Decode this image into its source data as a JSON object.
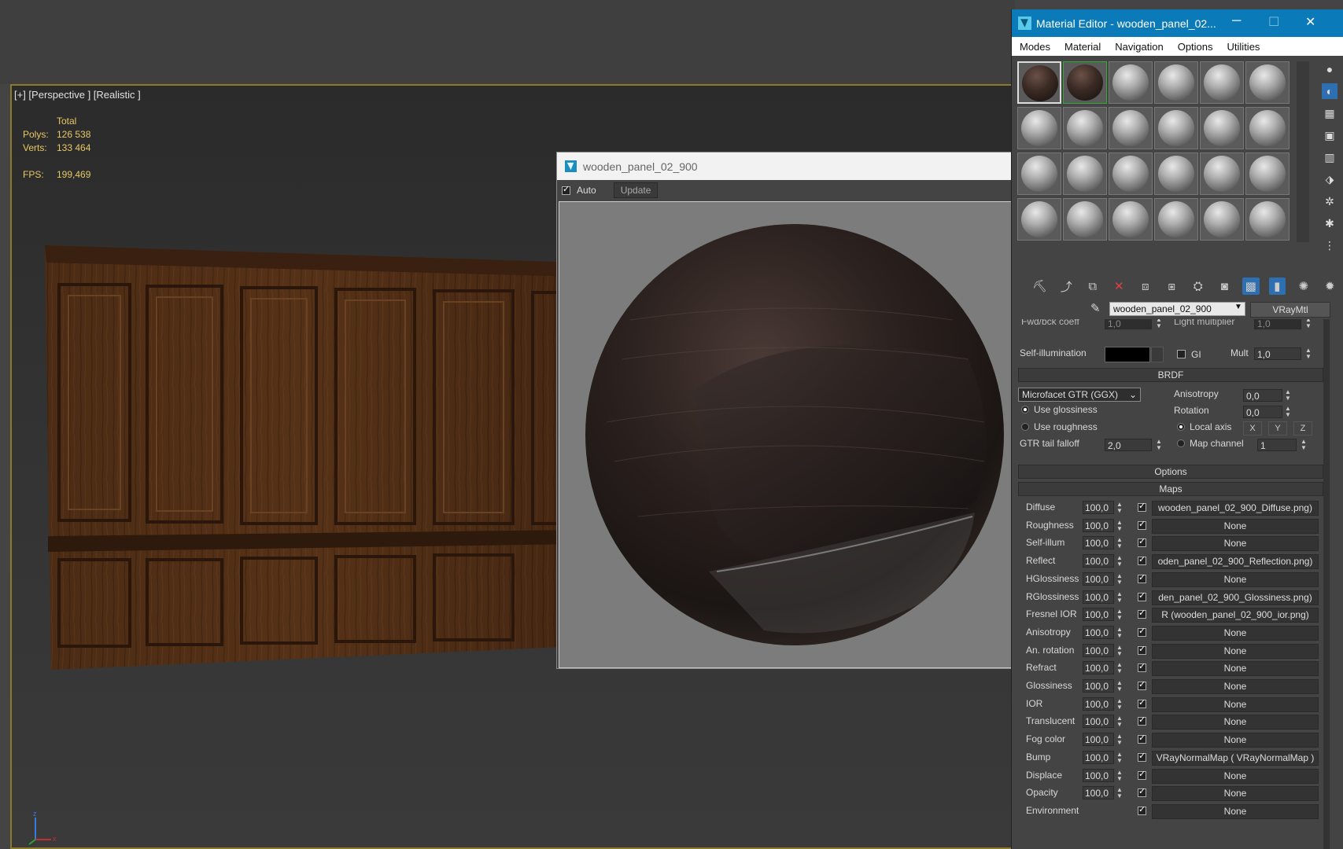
{
  "viewport": {
    "label": "[+] [Perspective ] [Realistic ]",
    "stats": {
      "header": "Total",
      "polys_label": "Polys:",
      "polys_value": "126 538",
      "verts_label": "Verts:",
      "verts_value": "133 464",
      "fps_label": "FPS:",
      "fps_value": "199,469"
    }
  },
  "preview_window": {
    "title": "wooden_panel_02_900",
    "auto_label": "Auto",
    "auto_checked": true,
    "update_label": "Update"
  },
  "material_editor": {
    "title": "Material Editor - wooden_panel_02...",
    "menu": [
      "Modes",
      "Material",
      "Navigation",
      "Options",
      "Utilities"
    ],
    "material_name": "wooden_panel_02_900",
    "material_type": "VRayMtl",
    "params": {
      "fwd_bck_label": "Fwd/bck coeff",
      "fwd_bck_value": "1,0",
      "light_mult_label": "Light multiplier",
      "light_mult_value": "1,0",
      "self_illum_label": "Self-illumination",
      "gi_label": "GI",
      "mult_label": "Mult",
      "mult_value": "1,0"
    },
    "brdf": {
      "rollout": "BRDF",
      "type": "Microfacet GTR (GGX)",
      "use_glossiness": "Use glossiness",
      "use_roughness": "Use roughness",
      "gtr_label": "GTR tail falloff",
      "gtr_value": "2,0",
      "anisotropy_label": "Anisotropy",
      "anisotropy_value": "0,0",
      "rotation_label": "Rotation",
      "rotation_value": "0,0",
      "local_axis_label": "Local axis",
      "x": "X",
      "y": "Y",
      "z": "Z",
      "map_channel_label": "Map channel",
      "map_channel_value": "1"
    },
    "options_rollout": "Options",
    "maps_rollout": "Maps",
    "maps": [
      {
        "label": "Diffuse",
        "value": "100,0",
        "map": "wooden_panel_02_900_Diffuse.png)"
      },
      {
        "label": "Roughness",
        "value": "100,0",
        "map": "None"
      },
      {
        "label": "Self-illum",
        "value": "100,0",
        "map": "None"
      },
      {
        "label": "Reflect",
        "value": "100,0",
        "map": "oden_panel_02_900_Reflection.png)"
      },
      {
        "label": "HGlossiness",
        "value": "100,0",
        "map": "None"
      },
      {
        "label": "RGlossiness",
        "value": "100,0",
        "map": "den_panel_02_900_Glossiness.png)"
      },
      {
        "label": "Fresnel IOR",
        "value": "100,0",
        "map": "R (wooden_panel_02_900_ior.png)"
      },
      {
        "label": "Anisotropy",
        "value": "100,0",
        "map": "None"
      },
      {
        "label": "An. rotation",
        "value": "100,0",
        "map": "None"
      },
      {
        "label": "Refract",
        "value": "100,0",
        "map": "None"
      },
      {
        "label": "Glossiness",
        "value": "100,0",
        "map": "None"
      },
      {
        "label": "IOR",
        "value": "100,0",
        "map": "None"
      },
      {
        "label": "Translucent",
        "value": "100,0",
        "map": "None"
      },
      {
        "label": "Fog color",
        "value": "100,0",
        "map": "None"
      },
      {
        "label": "Bump",
        "value": "100,0",
        "map": "VRayNormalMap ( VRayNormalMap )"
      },
      {
        "label": "Displace",
        "value": "100,0",
        "map": "None"
      },
      {
        "label": "Opacity",
        "value": "100,0",
        "map": "None"
      },
      {
        "label": "Environment",
        "value": "",
        "map": "None"
      }
    ]
  },
  "colors": {
    "accent": "#0a7ab8",
    "viewport_border": "#8a7a2a",
    "stats_text": "#e8c864"
  }
}
